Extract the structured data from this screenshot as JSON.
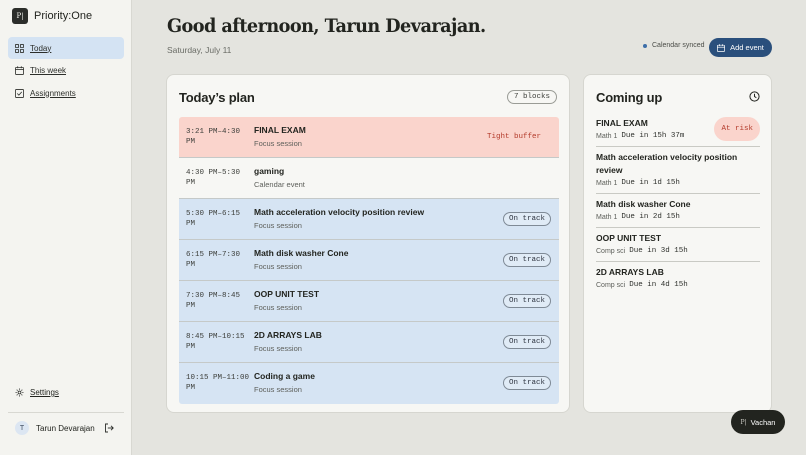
{
  "app": {
    "logo_text": "P|",
    "name": "Priority:One"
  },
  "sidebar": {
    "items": [
      {
        "label": "Today",
        "icon": "grid-icon",
        "active": true
      },
      {
        "label": "This week",
        "icon": "calendar-icon",
        "active": false
      },
      {
        "label": "Assignments",
        "icon": "checkbox-icon",
        "active": false
      }
    ],
    "settings_label": "Settings",
    "user": {
      "initial": "T",
      "name": "Tarun Devarajan"
    }
  },
  "header": {
    "greeting": "Good afternoon, Tarun Devarajan.",
    "date": "Saturday, July 11",
    "sync_status": "Calendar synced",
    "add_event_label": "Add event"
  },
  "plan": {
    "title": "Today’s plan",
    "blocks_badge": "7 blocks",
    "rows": [
      {
        "time": "3:21 PM–4:30 PM",
        "title": "FINAL EXAM",
        "subtitle": "Focus session",
        "status": "Tight buffer",
        "kind": "risk"
      },
      {
        "time": "4:30 PM–5:30 PM",
        "title": "gaming",
        "subtitle": "Calendar event",
        "status": "",
        "kind": "plain"
      },
      {
        "time": "5:30 PM–6:15 PM",
        "title": "Math acceleration velocity position review",
        "subtitle": "Focus session",
        "status": "On track",
        "kind": "focus"
      },
      {
        "time": "6:15 PM–7:30 PM",
        "title": "Math disk washer Cone",
        "subtitle": "Focus session",
        "status": "On track",
        "kind": "focus"
      },
      {
        "time": "7:30 PM–8:45 PM",
        "title": "OOP UNIT TEST",
        "subtitle": "Focus session",
        "status": "On track",
        "kind": "focus"
      },
      {
        "time": "8:45 PM–10:15 PM",
        "title": "2D ARRAYS LAB",
        "subtitle": "Focus session",
        "status": "On track",
        "kind": "focus"
      },
      {
        "time": "10:15 PM–11:00 PM",
        "title": "Coding a game",
        "subtitle": "Focus session",
        "status": "On track",
        "kind": "focus"
      }
    ]
  },
  "upcoming": {
    "title": "Coming up",
    "items": [
      {
        "title": "FINAL EXAM",
        "course": "Math 1",
        "due": "Due in 15h 37m",
        "badge": "At risk"
      },
      {
        "title": "Math acceleration velocity position review",
        "course": "Math 1",
        "due": "Due in 1d 15h",
        "badge": ""
      },
      {
        "title": "Math disk washer Cone",
        "course": "Math 1",
        "due": "Due in 2d 15h",
        "badge": ""
      },
      {
        "title": "OOP UNIT TEST",
        "course": "Comp sci",
        "due": "Due in 3d 15h",
        "badge": ""
      },
      {
        "title": "2D ARRAYS LAB",
        "course": "Comp sci",
        "due": "Due in 4d 15h",
        "badge": ""
      }
    ]
  },
  "assistant": {
    "mark": "P|",
    "label": "Vachan"
  },
  "colors": {
    "accent": "#2a4f7c",
    "risk_bg": "#fad4cc",
    "risk_text": "#b33a2a",
    "focus_bg": "#d6e4f3",
    "active_nav": "#d4e3f3"
  }
}
